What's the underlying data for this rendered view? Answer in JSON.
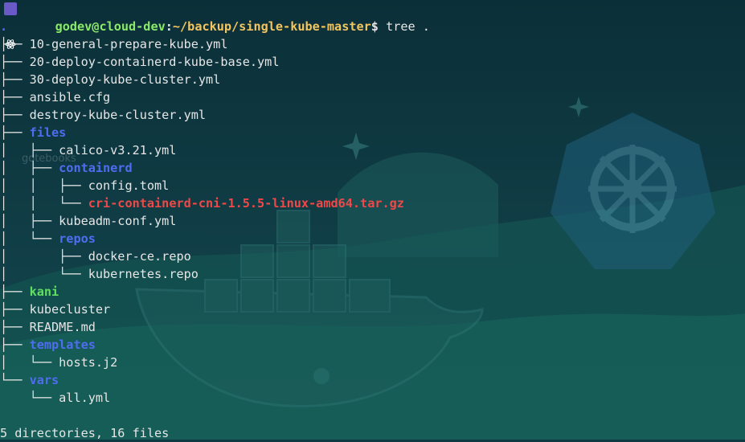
{
  "prompt": {
    "icon": "react-atom-icon",
    "user_host": "godev@cloud-dev",
    "separator": ":",
    "path": "~/backup/single-kube-master",
    "symbol": "$",
    "command": "tree ."
  },
  "tree": {
    "root": ".",
    "entries": [
      {
        "prefix": "├── ",
        "name": "10-general-prepare-kube.yml",
        "kind": "file"
      },
      {
        "prefix": "├── ",
        "name": "20-deploy-containerd-kube-base.yml",
        "kind": "file"
      },
      {
        "prefix": "├── ",
        "name": "30-deploy-kube-cluster.yml",
        "kind": "file"
      },
      {
        "prefix": "├── ",
        "name": "ansible.cfg",
        "kind": "file"
      },
      {
        "prefix": "├── ",
        "name": "destroy-kube-cluster.yml",
        "kind": "file"
      },
      {
        "prefix": "├── ",
        "name": "files",
        "kind": "dir"
      },
      {
        "prefix": "│   ├── ",
        "name": "calico-v3.21.yml",
        "kind": "file"
      },
      {
        "prefix": "│   ├── ",
        "name": "containerd",
        "kind": "dir"
      },
      {
        "prefix": "│   │   ├── ",
        "name": "config.toml",
        "kind": "file"
      },
      {
        "prefix": "│   │   └── ",
        "name": "cri-containerd-cni-1.5.5-linux-amd64.tar.gz",
        "kind": "archive"
      },
      {
        "prefix": "│   ├── ",
        "name": "kubeadm-conf.yml",
        "kind": "file"
      },
      {
        "prefix": "│   └── ",
        "name": "repos",
        "kind": "dir"
      },
      {
        "prefix": "│       ├── ",
        "name": "docker-ce.repo",
        "kind": "file"
      },
      {
        "prefix": "│       └── ",
        "name": "kubernetes.repo",
        "kind": "file"
      },
      {
        "prefix": "├── ",
        "name": "kani",
        "kind": "exec"
      },
      {
        "prefix": "├── ",
        "name": "kubecluster",
        "kind": "file"
      },
      {
        "prefix": "├── ",
        "name": "README.md",
        "kind": "file"
      },
      {
        "prefix": "├── ",
        "name": "templates",
        "kind": "dir"
      },
      {
        "prefix": "│   └── ",
        "name": "hosts.j2",
        "kind": "file"
      },
      {
        "prefix": "└── ",
        "name": "vars",
        "kind": "dir"
      },
      {
        "prefix": "    └── ",
        "name": "all.yml",
        "kind": "file"
      }
    ],
    "summary": "5 directories, 16 files"
  },
  "watermark": "gotebooks",
  "colors": {
    "background": "#0f3a44",
    "user_host": "#8be96a",
    "path": "#f2c560",
    "directory": "#4f6df0",
    "executable": "#5fe05f",
    "archive": "#f04848",
    "text": "#e6e6e6"
  },
  "decor": {
    "background_icons": [
      "kubernetes-helm-icon",
      "docker-whale-icon",
      "sparkle-icon"
    ]
  }
}
